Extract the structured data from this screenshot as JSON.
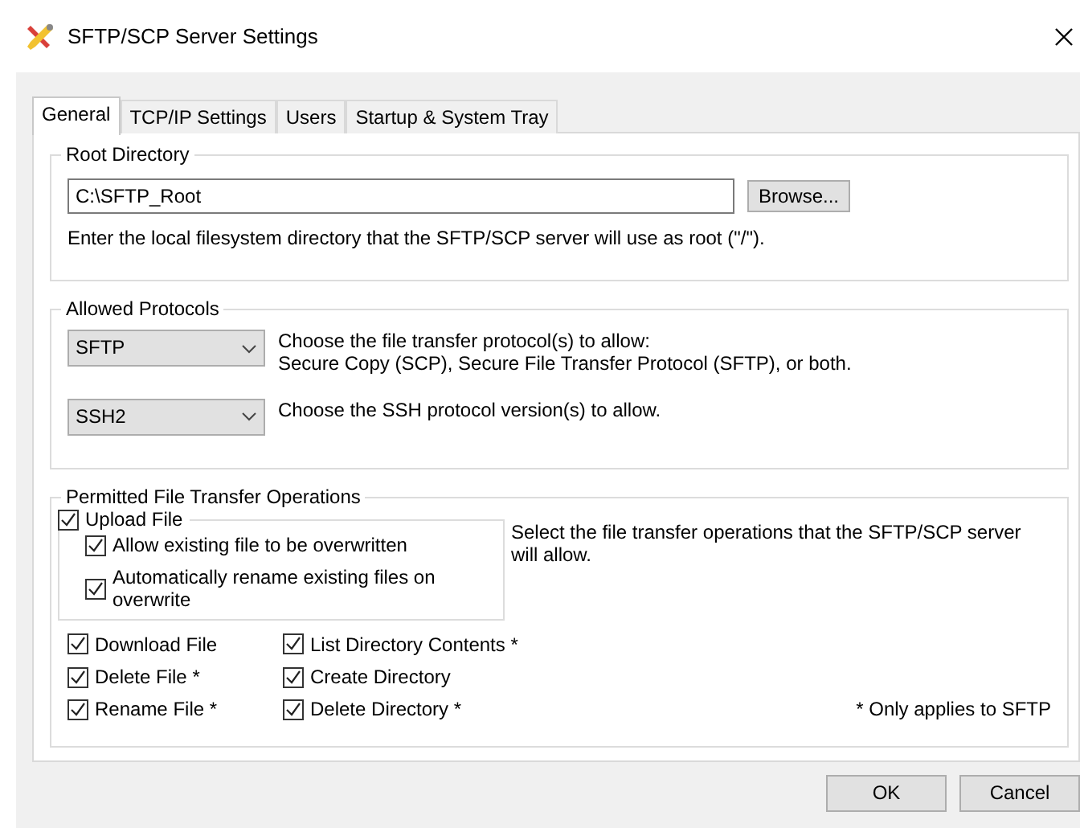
{
  "window": {
    "title": "SFTP/SCP Server Settings"
  },
  "tabs": [
    {
      "label": "General",
      "selected": true
    },
    {
      "label": "TCP/IP Settings",
      "selected": false
    },
    {
      "label": "Users",
      "selected": false
    },
    {
      "label": "Startup & System Tray",
      "selected": false
    }
  ],
  "root_directory": {
    "legend": "Root Directory",
    "value": "C:\\SFTP_Root",
    "browse_button": "Browse...",
    "hint": "Enter the local filesystem directory that the SFTP/SCP server will use as root (\"/\")."
  },
  "allowed_protocols": {
    "legend": "Allowed Protocols",
    "rows": [
      {
        "value": "SFTP",
        "description_lines": [
          "Choose the file transfer protocol(s) to allow:",
          "Secure Copy (SCP), Secure File Transfer Protocol (SFTP), or both."
        ]
      },
      {
        "value": "SSH2",
        "description_lines": [
          "Choose the SSH protocol version(s) to allow."
        ]
      }
    ]
  },
  "operations": {
    "legend": "Permitted File Transfer Operations",
    "upload": {
      "label": "Upload File",
      "checked": true,
      "children": [
        {
          "label": "Allow existing file to be overwritten",
          "checked": true
        },
        {
          "label": "Automatically rename existing files on overwrite",
          "checked": true
        }
      ]
    },
    "description": "Select the file transfer operations that the SFTP/SCP server will allow.",
    "items": [
      {
        "label": "Download File",
        "checked": true
      },
      {
        "label": "List Directory Contents *",
        "checked": true
      },
      {
        "label": "Delete File *",
        "checked": true
      },
      {
        "label": "Create Directory",
        "checked": true
      },
      {
        "label": "Rename File *",
        "checked": true
      },
      {
        "label": "Delete Directory *",
        "checked": true
      }
    ],
    "footnote": "* Only applies to SFTP"
  },
  "buttons": [
    {
      "label": "OK"
    },
    {
      "label": "Cancel"
    }
  ]
}
